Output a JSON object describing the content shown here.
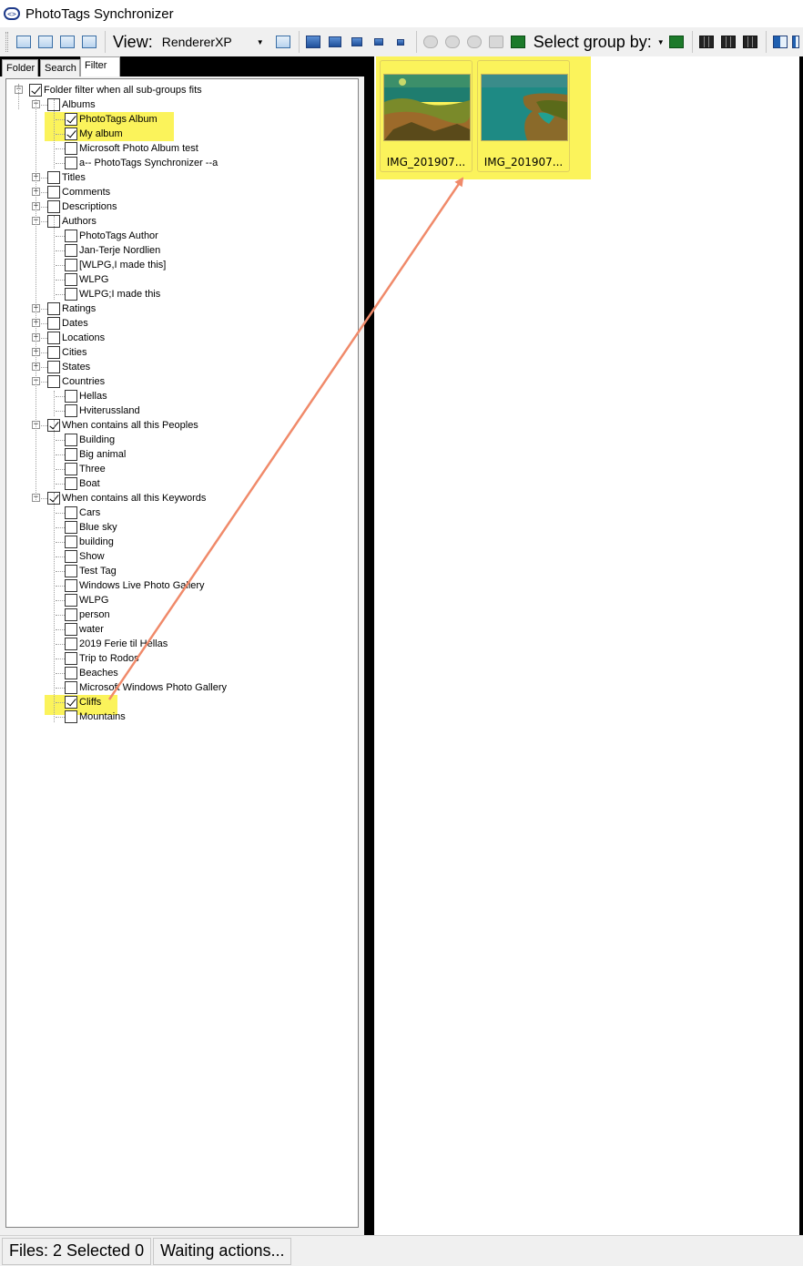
{
  "window": {
    "title": "PhotoTags Synchronizer",
    "icon": "app-icon"
  },
  "toolbar": {
    "view_label": "View:",
    "view_value": "RendererXP",
    "select_group_label": "Select group by:",
    "left_icons": [
      "layout-grid-icon",
      "layout-filmstrip-icon",
      "layout-columns-icon",
      "layout-details-icon"
    ],
    "thumb_size_icons": [
      "view-list-icon",
      "thumb-xl-icon",
      "thumb-l-icon",
      "thumb-m-icon",
      "thumb-s-icon",
      "thumb-xs-icon"
    ],
    "disabled_icons": [
      "rotate-left-icon",
      "rotate-icon",
      "rotate-right-icon",
      "print-icon"
    ],
    "right_icons": [
      "refresh-icon",
      "group-refresh-icon",
      "grid-dark-1-icon",
      "grid-dark-2-icon",
      "grid-dark-3-icon",
      "panel-icon",
      "panel-more-icon"
    ]
  },
  "tabs": [
    {
      "label": "Folder",
      "active": false
    },
    {
      "label": "Search",
      "active": false
    },
    {
      "label": "Filter",
      "active": true
    }
  ],
  "tree": [
    {
      "label": "Folder filter  when all sub-groups fits",
      "level": 0,
      "checked": true,
      "expander": "minus"
    },
    {
      "label": "Albums",
      "level": 1,
      "checked": false,
      "expander": "minus"
    },
    {
      "label": "PhotoTags Album",
      "level": 2,
      "checked": true,
      "expander": null,
      "highlight": true
    },
    {
      "label": "My album",
      "level": 2,
      "checked": true,
      "expander": null,
      "highlight": true
    },
    {
      "label": "Microsoft Photo Album test",
      "level": 2,
      "checked": false,
      "expander": null
    },
    {
      "label": "a-- PhotoTags Synchronizer --a",
      "level": 2,
      "checked": false,
      "expander": null
    },
    {
      "label": "Titles",
      "level": 1,
      "checked": false,
      "expander": "plus"
    },
    {
      "label": "Comments",
      "level": 1,
      "checked": false,
      "expander": "plus"
    },
    {
      "label": "Descriptions",
      "level": 1,
      "checked": false,
      "expander": "plus"
    },
    {
      "label": "Authors",
      "level": 1,
      "checked": false,
      "expander": "minus"
    },
    {
      "label": "PhotoTags Author",
      "level": 2,
      "checked": false,
      "expander": null
    },
    {
      "label": "Jan-Terje Nordlien",
      "level": 2,
      "checked": false,
      "expander": null
    },
    {
      "label": "[WLPG,I made this]",
      "level": 2,
      "checked": false,
      "expander": null
    },
    {
      "label": "WLPG",
      "level": 2,
      "checked": false,
      "expander": null
    },
    {
      "label": "WLPG;I made this",
      "level": 2,
      "checked": false,
      "expander": null
    },
    {
      "label": "Ratings",
      "level": 1,
      "checked": false,
      "expander": "plus"
    },
    {
      "label": "Dates",
      "level": 1,
      "checked": false,
      "expander": "plus"
    },
    {
      "label": "Locations",
      "level": 1,
      "checked": false,
      "expander": "plus"
    },
    {
      "label": "Cities",
      "level": 1,
      "checked": false,
      "expander": "plus"
    },
    {
      "label": "States",
      "level": 1,
      "checked": false,
      "expander": "plus"
    },
    {
      "label": "Countries",
      "level": 1,
      "checked": false,
      "expander": "minus"
    },
    {
      "label": "Hellas",
      "level": 2,
      "checked": false,
      "expander": null
    },
    {
      "label": "Hviterussland",
      "level": 2,
      "checked": false,
      "expander": null
    },
    {
      "label": "When contains all this Peoples",
      "level": 1,
      "checked": true,
      "expander": "minus"
    },
    {
      "label": "Building",
      "level": 2,
      "checked": false,
      "expander": null
    },
    {
      "label": "Big animal",
      "level": 2,
      "checked": false,
      "expander": null
    },
    {
      "label": "Three",
      "level": 2,
      "checked": false,
      "expander": null
    },
    {
      "label": "Boat",
      "level": 2,
      "checked": false,
      "expander": null
    },
    {
      "label": "When contains all this Keywords",
      "level": 1,
      "checked": true,
      "expander": "minus"
    },
    {
      "label": "Cars",
      "level": 2,
      "checked": false,
      "expander": null
    },
    {
      "label": "Blue sky",
      "level": 2,
      "checked": false,
      "expander": null
    },
    {
      "label": "building",
      "level": 2,
      "checked": false,
      "expander": null
    },
    {
      "label": "Show",
      "level": 2,
      "checked": false,
      "expander": null
    },
    {
      "label": "Test Tag",
      "level": 2,
      "checked": false,
      "expander": null
    },
    {
      "label": "Windows Live Photo Gallery",
      "level": 2,
      "checked": false,
      "expander": null
    },
    {
      "label": "WLPG",
      "level": 2,
      "checked": false,
      "expander": null
    },
    {
      "label": "person",
      "level": 2,
      "checked": false,
      "expander": null
    },
    {
      "label": "water",
      "level": 2,
      "checked": false,
      "expander": null
    },
    {
      "label": "2019 Ferie til Hellas",
      "level": 2,
      "checked": false,
      "expander": null
    },
    {
      "label": "Trip to Rodos",
      "level": 2,
      "checked": false,
      "expander": null
    },
    {
      "label": "Beaches",
      "level": 2,
      "checked": false,
      "expander": null
    },
    {
      "label": "Microsoft Windows Photo Gallery",
      "level": 2,
      "checked": false,
      "expander": null
    },
    {
      "label": "Cliffs",
      "level": 2,
      "checked": true,
      "expander": null,
      "highlight": true
    },
    {
      "label": "Mountains",
      "level": 2,
      "checked": false,
      "expander": null
    }
  ],
  "thumbnails": [
    {
      "caption": "IMG_201907...",
      "icon": "photo-coast-icon"
    },
    {
      "caption": "IMG_201907...",
      "icon": "photo-cliffs-icon"
    }
  ],
  "status": {
    "files": "Files: 2 Selected 0",
    "actions": "Waiting actions..."
  },
  "colors": {
    "highlight": "#fbf35b",
    "arrow": "#f08a6a",
    "splitter": "#000000"
  }
}
